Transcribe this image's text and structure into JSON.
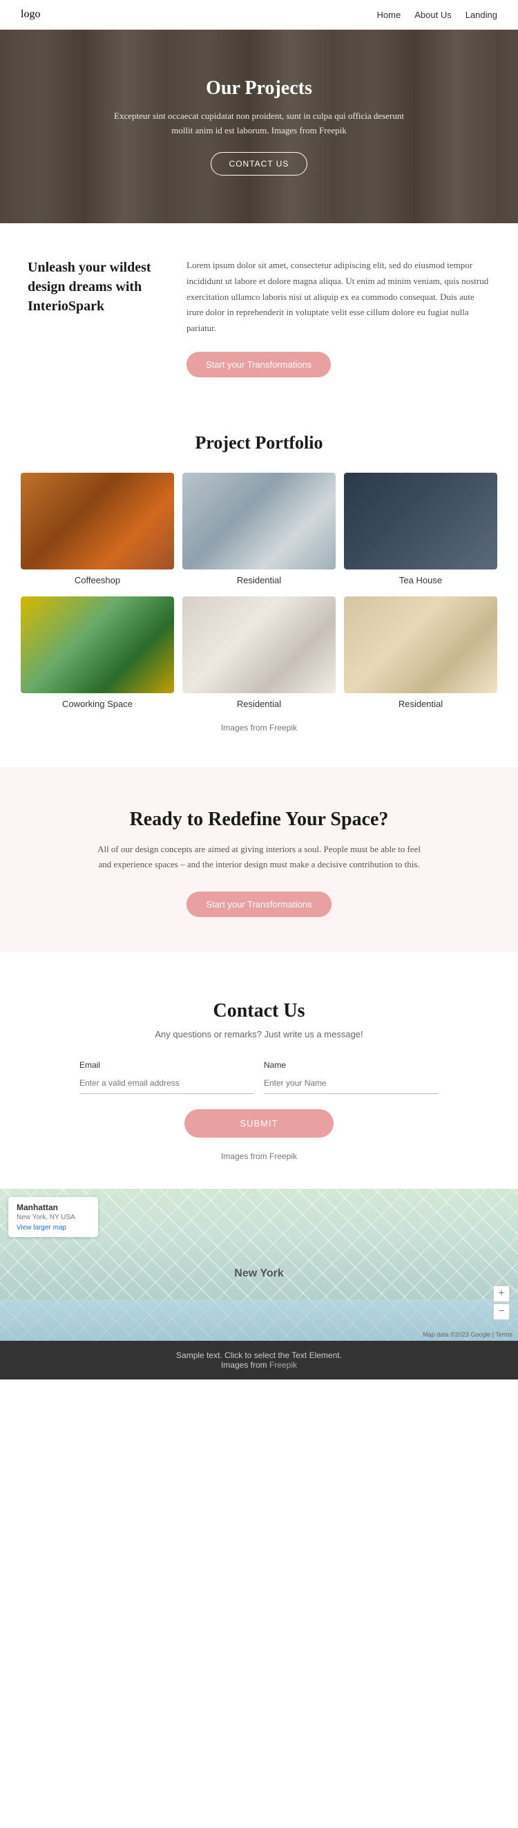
{
  "nav": {
    "logo": "logo",
    "links": [
      {
        "label": "Home",
        "href": "#"
      },
      {
        "label": "About Us",
        "href": "#"
      },
      {
        "label": "Landing",
        "href": "#"
      }
    ]
  },
  "hero": {
    "title": "Our Projects",
    "subtitle": "Excepteur sint occaecat cupidatat non proident, sunt in culpa qui officia deserunt mollit anim id est laborum. Images from",
    "freepik_link": "Freepik",
    "cta_btn": "CONTACT US"
  },
  "intro": {
    "heading": "Unleash your wildest design dreams with InterioSpark",
    "body": "Lorem ipsum dolor sit amet, consectetur adipiscing elit, sed do eiusmod tempor incididunt ut labore et dolore magna aliqua. Ut enim ad minim veniam, quis nostrud exercitation ullamco laboris nisi ut aliquip ex ea commodo consequat. Duis aute irure dolor in reprehenderit in voluptate velit esse cillum dolore eu fugiat nulla pariatur.",
    "cta_btn": "Start your Transformations"
  },
  "portfolio": {
    "title": "Project Portfolio",
    "items": [
      {
        "label": "Coffeeshop",
        "img_class": "img-coffeeshop"
      },
      {
        "label": "Residential",
        "img_class": "img-residential1"
      },
      {
        "label": "Tea House",
        "img_class": "img-teahouse"
      },
      {
        "label": "Coworking Space",
        "img_class": "img-coworking"
      },
      {
        "label": "Residential",
        "img_class": "img-residential2"
      },
      {
        "label": "Residential",
        "img_class": "img-residential3"
      }
    ],
    "footer_text": "Images from",
    "footer_link": "Freepik"
  },
  "cta": {
    "title": "Ready to Redefine Your Space?",
    "subtitle": "All of our design concepts are aimed at giving interiors a soul. People must be able to feel and experience spaces – and the interior design must make a decisive contribution to this.",
    "btn": "Start your Transformations"
  },
  "contact": {
    "title": "Contact Us",
    "subtitle": "Any questions or remarks? Just write us a message!",
    "email_label": "Email",
    "email_placeholder": "Enter a valid email address",
    "name_label": "Name",
    "name_placeholder": "Enter your Name",
    "submit_btn": "SUBMIT",
    "footer_text": "Images from",
    "footer_link": "Freepik"
  },
  "map": {
    "place_name": "Manhattan",
    "place_addr": "New York, NY USA",
    "map_link": "View larger map",
    "label": "New York",
    "attribution": "Map data ©2023 Google | Terms"
  },
  "footer": {
    "text": "Sample text. Click to select the Text Element.",
    "images_text": "Images from",
    "freepik_link": "Freepik"
  }
}
